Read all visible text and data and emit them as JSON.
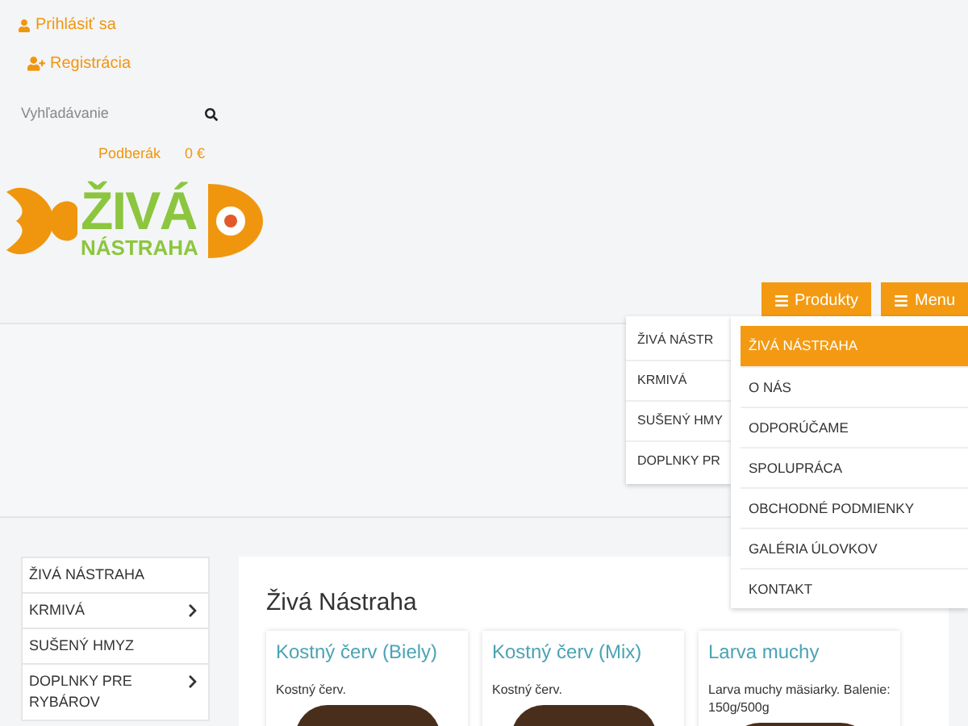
{
  "account_links": [
    {
      "kind": "login",
      "label": "Prihlásiť sa"
    },
    {
      "kind": "register",
      "label": "Registrácia"
    }
  ],
  "search": {
    "placeholder": "Vyhľadávanie"
  },
  "cart": {
    "label": "Podberák",
    "total": "0 €"
  },
  "logo": {
    "line_1": "ŽIVÁ",
    "line_2": "NÁSTRAHA"
  },
  "nav_buttons": [
    {
      "label": "Produkty"
    },
    {
      "label": "Menu"
    }
  ],
  "products_dropdown": [
    "ŽIVÁ NÁSTR",
    "KRMIVÁ",
    "SUŠENÝ HMY",
    "DOPLNKY PR"
  ],
  "menu_dropdown": [
    {
      "label": "ŽIVÁ NÁSTRAHA",
      "selected": true
    },
    {
      "label": "O NÁS",
      "selected": false
    },
    {
      "label": "ODPORÚČAME",
      "selected": false
    },
    {
      "label": "SPOLUPRÁCA",
      "selected": false
    },
    {
      "label": "OBCHODNÉ PODMIENKY",
      "selected": false
    },
    {
      "label": "GALÉRIA ÚLOVKOV",
      "selected": false
    },
    {
      "label": "KONTAKT",
      "selected": false
    }
  ],
  "sidebar": {
    "items": [
      {
        "label": "ŽIVÁ NÁSTRAHA",
        "expandable": false
      },
      {
        "label": "KRMIVÁ",
        "expandable": true
      },
      {
        "label": "SUŠENÝ HMYZ",
        "expandable": false
      },
      {
        "label": "DOPLNKY PRE RYBÁROV",
        "expandable": true
      }
    ]
  },
  "content": {
    "title": "Živá Nástraha",
    "products": [
      {
        "name": "Kostný červ (Biely)",
        "description": "Kostný červ."
      },
      {
        "name": "Kostný červ (Mix)",
        "description": "Kostný červ."
      },
      {
        "name": "Larva muchy",
        "description": "Larva muchy mäsiarky. Balenie: 150g/500g"
      }
    ]
  }
}
